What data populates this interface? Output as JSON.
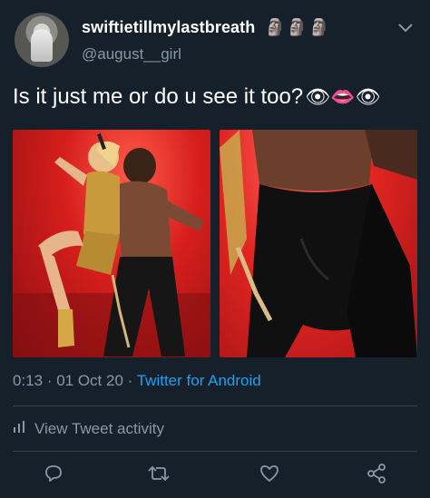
{
  "tweet": {
    "user": {
      "display_name": "swiftietillmylastbreath",
      "name_emoji": "🗿🗿🗿",
      "handle": "@august__girl"
    },
    "text": "Is it just me or do u see it too?",
    "text_emoji": "👁👄👁",
    "meta": {
      "time": "0:13",
      "separator": " · ",
      "date": "01 Oct 20",
      "source": "Twitter for Android"
    },
    "activity_label": "View Tweet activity"
  },
  "icons": {
    "menu": "chevron-down-icon",
    "activity": "bar-chart-icon",
    "reply": "reply-icon",
    "retweet": "retweet-icon",
    "like": "heart-icon",
    "share": "share-icon"
  },
  "colors": {
    "background": "#15202b",
    "text_primary": "#ffffff",
    "text_secondary": "#8899a6",
    "link": "#1da1f2",
    "divider": "#38444d"
  }
}
